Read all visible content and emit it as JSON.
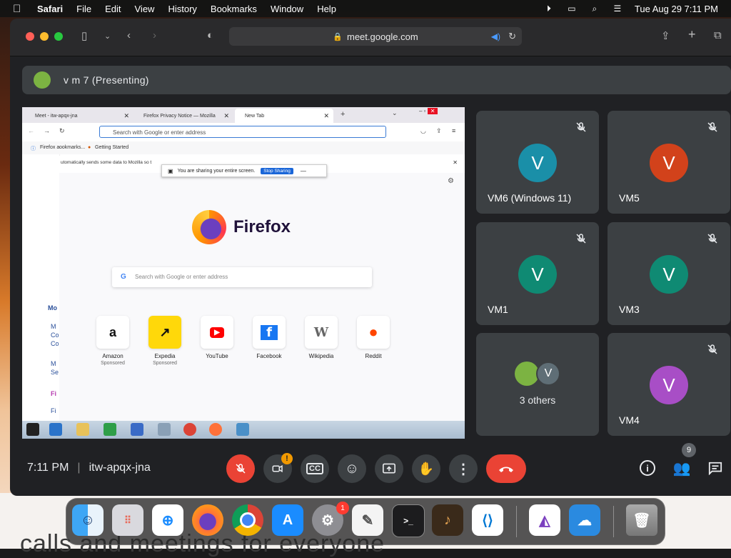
{
  "menubar": {
    "app": "Safari",
    "items": [
      "File",
      "Edit",
      "View",
      "History",
      "Bookmarks",
      "Window",
      "Help"
    ],
    "clock": "Tue Aug 29  7:11 PM"
  },
  "browser": {
    "url": "meet.google.com"
  },
  "meet": {
    "presenter_label": "v m 7  (Presenting)",
    "time": "7:11 PM",
    "meeting_code": "itw-apqx-jna",
    "participants_count": "9",
    "camera_alert": "!",
    "tiles": [
      {
        "name": "VM6 (Windows 11)",
        "initial": "V",
        "color": "#1a8fa8"
      },
      {
        "name": "VM5",
        "initial": "V",
        "color": "#d2421b"
      },
      {
        "name": "VM1",
        "initial": "V",
        "color": "#0f8a73"
      },
      {
        "name": "VM3",
        "initial": "V",
        "color": "#0f8a73"
      },
      {
        "name": "VM4",
        "initial": "V",
        "color": "#a84ec6"
      }
    ],
    "others": {
      "label": "3 others",
      "initial": "V"
    }
  },
  "shared_screen": {
    "tabs": [
      "Meet - itw-apqx-jna",
      "Firefox Privacy Notice — Mozilla",
      "New Tab"
    ],
    "url_placeholder": "Search with Google or enter address",
    "bookmarks": [
      "Firefox a",
      "ookmarks...",
      "Getting Started"
    ],
    "notice": "utomatically sends some data to Mozilla so t",
    "share_toast": "You are sharing your entire screen.",
    "stop_sharing": "Stop Sharing",
    "brand": "Firefox",
    "search_placeholder": "Search with Google or enter address",
    "left_fragments": [
      "Mo",
      "M",
      "Co",
      "Co",
      "M",
      "Se",
      "Fi",
      "Fi"
    ],
    "sites": [
      {
        "name": "Amazon",
        "sponsored": "Sponsored",
        "glyph": "a",
        "color": "#111"
      },
      {
        "name": "Expedia",
        "sponsored": "Sponsored",
        "glyph": "↗",
        "color": "#111"
      },
      {
        "name": "YouTube",
        "sponsored": "",
        "glyph": "▶",
        "color": "#ff0000"
      },
      {
        "name": "Facebook",
        "sponsored": "",
        "glyph": "f",
        "color": "#1877f2"
      },
      {
        "name": "Wikipedia",
        "sponsored": "",
        "glyph": "W",
        "color": "#555"
      },
      {
        "name": "Reddit",
        "sponsored": "",
        "glyph": "●",
        "color": "#ff4500"
      }
    ]
  },
  "dock": {
    "settings_badge": "1"
  }
}
